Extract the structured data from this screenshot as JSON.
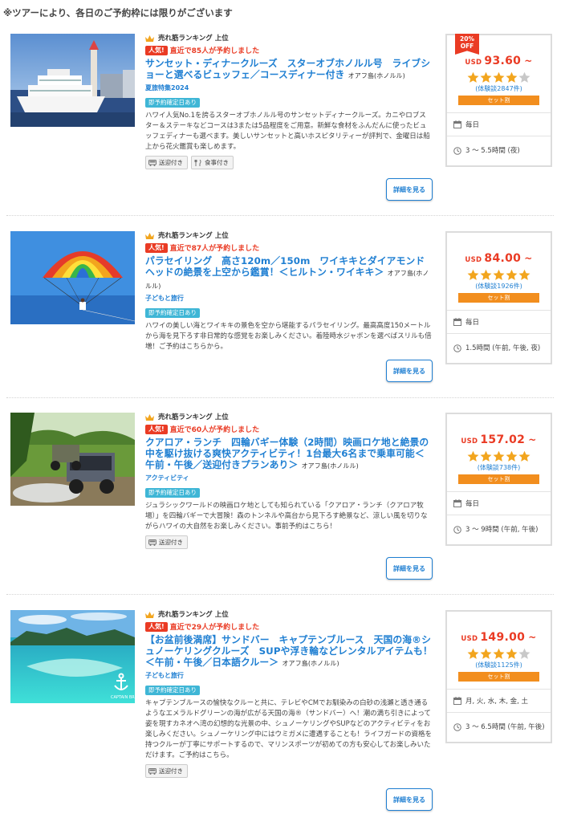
{
  "notice": "※ツアーにより、各日のご予約枠には限りがございます",
  "colors": {
    "accent_red": "#ea3b24",
    "link_blue": "#1f7fd2",
    "instant_badge": "#3fb6d6",
    "set_badge": "#f28e1e",
    "star": "#f2a51e"
  },
  "labels": {
    "rank": "売れ筋ランキング 上位",
    "hot": "人気!",
    "instant": "即予約確定日あり",
    "detail": "詳細を見る",
    "set": "セット割",
    "currency": "USD",
    "tilde": "~"
  },
  "tours": [
    {
      "image_icon": "cruise-ship-photo",
      "recent": "直近で85人が予約しました",
      "title": "サンセット・ディナークルーズ　スターオブホノルル号　ライブショーと選べるビュッフェ／コースディナー付き",
      "location": "オアフ島(ホノルル)",
      "category": "夏旅特集2024",
      "description": "ハワイ人気No.1を誇るスターオブホノルル号のサンセットディナークルーズ。カニやロブスター＆ステーキなどコースは3または5品程度をご用意。新鮮な食材をふんだんに使ったビュッフェディナーも選べます。美しいサンセットと高いホスピタリティーが評判で、金曜日は船上から花火鑑賞も楽しめます。",
      "tags": [
        "送迎付き",
        "食事付き"
      ],
      "discount": "20% OFF",
      "price": "93.60",
      "rating": 4,
      "reviews": "(体験談2847件)",
      "schedule": "毎日",
      "duration": "3 〜 5.5時間 (夜)"
    },
    {
      "image_icon": "parasailing-photo",
      "recent": "直近で87人が予約しました",
      "title": "パラセイリング　高さ120m／150m　ワイキキとダイアモンドヘッドの絶景を上空から鑑賞！＜ヒルトン・ワイキキ＞",
      "location": "オアフ島(ホノルル)",
      "category": "子どもと旅行",
      "description": "ハワイの美しい海とワイキキの景色を空から堪能するパラセイリング。最高高度150メートルから海を見下ろす非日常的な感覚をお楽しみください。着陸時水ジャボンを選べばスリルも倍増！ご予約はこちらから。",
      "tags": [],
      "discount": "",
      "price": "84.00",
      "rating": 5,
      "reviews": "(体験談1926件)",
      "schedule": "毎日",
      "duration": "1.5時間 (午前, 午後, 夜)"
    },
    {
      "image_icon": "atv-buggy-photo",
      "recent": "直近で60人が予約しました",
      "title": "クアロア・ランチ　四輪バギー体験（2時間）映画ロケ地と絶景の中を駆け抜ける爽快アクティビティ！1台最大6名まで乗車可能＜午前・午後／送迎付きプランあり＞",
      "location": "オアフ島(ホノルル)",
      "category": "アクティビティ",
      "description": "ジュラシックワールドの映画ロケ地としても知られている「クアロア・ランチ（クアロア牧場）」を四輪バギーで大冒険！森のトンネルや高台から見下ろす絶景など、涼しい風を切りながらハワイの大自然をお楽しみください。事前予約はこちら！",
      "tags": [
        "送迎付き"
      ],
      "discount": "",
      "price": "157.02",
      "rating": 5,
      "reviews": "(体験談738件)",
      "schedule": "毎日",
      "duration": "3 〜 9時間 (午前, 午後)"
    },
    {
      "image_icon": "sandbar-beach-photo",
      "recent": "直近で29人が予約しました",
      "title": "【お盆前後満席】サンドバー　キャプテンブルース　天国の海®シュノーケリングクルーズ　SUPや浮き輪などレンタルアイテムも！＜午前・午後／日本語クルー＞",
      "location": "オアフ島(ホノルル)",
      "category": "子どもと旅行",
      "description": "キャプテンブルースの愉快なクルーと共に、テレビやCMでお馴染みの白砂の浅瀬と透き通るようなエメラルドグリーンの海が広がる天国の海®（サンドバー）へ！潮の満ち引きによって姿を現すカネオヘ湾の幻想的な光景の中、シュノーケリングやSUPなどのアクティビティをお楽しみください。シュノーケリング中にはウミガメに遭遇することも！ライフガードの資格を持つクルーが丁寧にサポートするので、マリンスポーツが初めての方も安心してお楽しみいただけます。ご予約はこちら。",
      "tags": [
        "送迎付き"
      ],
      "discount": "",
      "price": "149.00",
      "rating": 4,
      "reviews": "(体験談1125件)",
      "schedule": "月, 火, 水, 木, 金, 土",
      "duration": "3 〜 6.5時間 (午前, 午後)"
    }
  ]
}
